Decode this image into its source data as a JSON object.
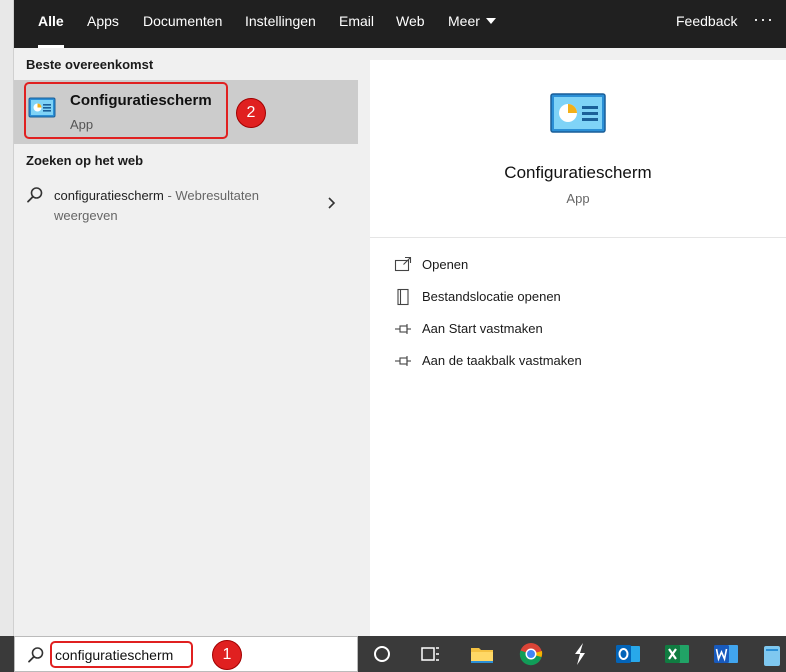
{
  "nav": {
    "tabs": [
      {
        "label": "Alle",
        "active": true
      },
      {
        "label": "Apps"
      },
      {
        "label": "Documenten"
      },
      {
        "label": "Instellingen"
      },
      {
        "label": "Email"
      },
      {
        "label": "Web"
      },
      {
        "label": "Meer"
      }
    ],
    "feedback_label": "Feedback",
    "more_options": "···"
  },
  "left": {
    "best_match_label": "Beste overeenkomst",
    "best_match": {
      "title": "Configuratiescherm",
      "subtitle": "App"
    },
    "web_section_label": "Zoeken op het web",
    "web_result": {
      "query": "configuratiescherm",
      "suffix": " - Webresultaten weergeven"
    }
  },
  "right": {
    "title": "Configuratiescherm",
    "subtitle": "App",
    "actions": [
      {
        "label": "Openen",
        "icon": "open-icon"
      },
      {
        "label": "Bestandslocatie openen",
        "icon": "file-location-icon"
      },
      {
        "label": "Aan Start vastmaken",
        "icon": "pin-icon"
      },
      {
        "label": "Aan de taakbalk vastmaken",
        "icon": "pin-icon"
      }
    ]
  },
  "search": {
    "value": "configuratiescherm"
  },
  "annotations": {
    "step1": "1",
    "step2": "2"
  },
  "taskbar": {
    "icons": [
      "cortana-icon",
      "task-view-icon",
      "file-explorer-icon",
      "chrome-icon",
      "app-icon",
      "outlook-icon",
      "excel-icon",
      "word-icon",
      "app-icon"
    ]
  },
  "colors": {
    "nav_bg": "#202020",
    "selected_row": "#cccccc",
    "panel_bg": "#f0f0f0",
    "taskbar_bg": "#3a3a3a",
    "annotation_red": "#e02020"
  }
}
